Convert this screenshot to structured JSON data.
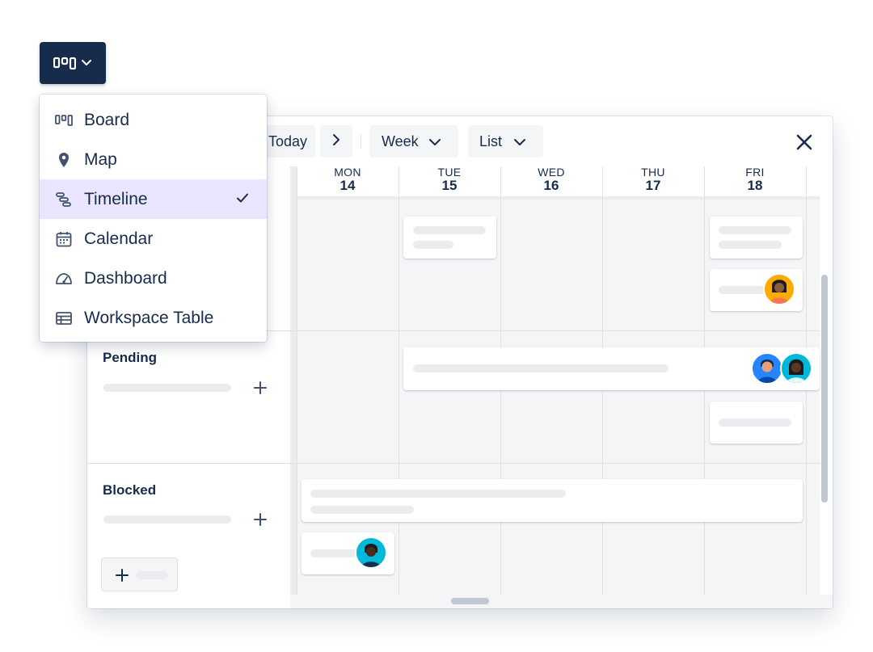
{
  "switcher": {
    "icon": "board-view-icon",
    "chevron": "chevron-down-icon"
  },
  "menu": {
    "items": [
      {
        "label": "Board",
        "icon": "board-icon",
        "selected": false
      },
      {
        "label": "Map",
        "icon": "map-pin-icon",
        "selected": false
      },
      {
        "label": "Timeline",
        "icon": "timeline-icon",
        "selected": true
      },
      {
        "label": "Calendar",
        "icon": "calendar-icon",
        "selected": false
      },
      {
        "label": "Dashboard",
        "icon": "dashboard-icon",
        "selected": false
      },
      {
        "label": "Workspace Table",
        "icon": "table-icon",
        "selected": false
      }
    ]
  },
  "toolbar": {
    "today_label": "Today",
    "week_label": "Week",
    "list_label": "List"
  },
  "days": [
    {
      "name": "MON",
      "num": "14"
    },
    {
      "name": "TUE",
      "num": "15"
    },
    {
      "name": "WED",
      "num": "16"
    },
    {
      "name": "THU",
      "num": "17"
    },
    {
      "name": "FRI",
      "num": "18"
    }
  ],
  "groups": [
    {
      "title": "Pending"
    },
    {
      "title": "Blocked"
    }
  ],
  "colors": {
    "navy": "#172b4d",
    "selected_bg": "#eae6ff",
    "grid_bg": "#f4f5f7",
    "placeholder": "#ebecf0",
    "avatar_yellow": "#ffab00",
    "avatar_blue": "#2684ff",
    "avatar_teal": "#00b8d9"
  }
}
